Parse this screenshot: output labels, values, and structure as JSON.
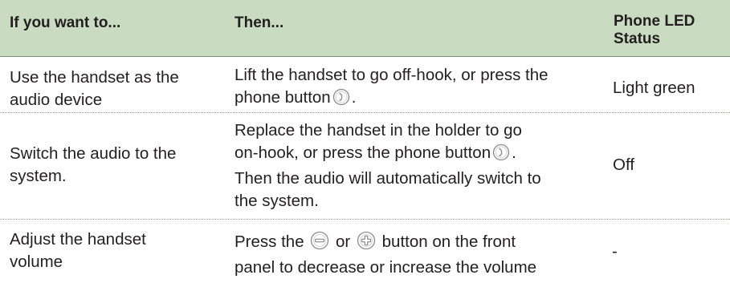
{
  "header": {
    "col1": "If you want to...",
    "col2": "Then...",
    "col3_line1": "Phone LED",
    "col3_line2": "Status"
  },
  "rows": [
    {
      "want_lines": [
        "Use the handset as the",
        "audio device"
      ],
      "then_line1": "Lift the handset to go off-hook, or press the",
      "then_line2_pre": "phone button",
      "then_line2_post": ".",
      "status": "Light green"
    },
    {
      "want_lines": [
        "Switch the audio to the",
        "system."
      ],
      "then_line1": "Replace the handset in the holder to go",
      "then_line2_pre": "on-hook, or press the phone button",
      "then_line2_post": ".",
      "then_line3": "Then the audio will automatically switch to",
      "then_line4": "the system.",
      "status": "Off"
    },
    {
      "want_lines": [
        "Adjust the handset",
        "volume"
      ],
      "then_line1_pre": "Press the",
      "then_line1_mid": "or",
      "then_line1_post": "button on the front",
      "then_line2": "panel to decrease or increase the volume",
      "status": "-"
    }
  ],
  "icons": {
    "phone": "phone-button-icon",
    "minus": "volume-down-button-icon",
    "plus": "volume-up-button-icon"
  },
  "colors": {
    "header_bg": "#c9dbc0",
    "text": "#231f20",
    "rule": "#9aa597"
  }
}
